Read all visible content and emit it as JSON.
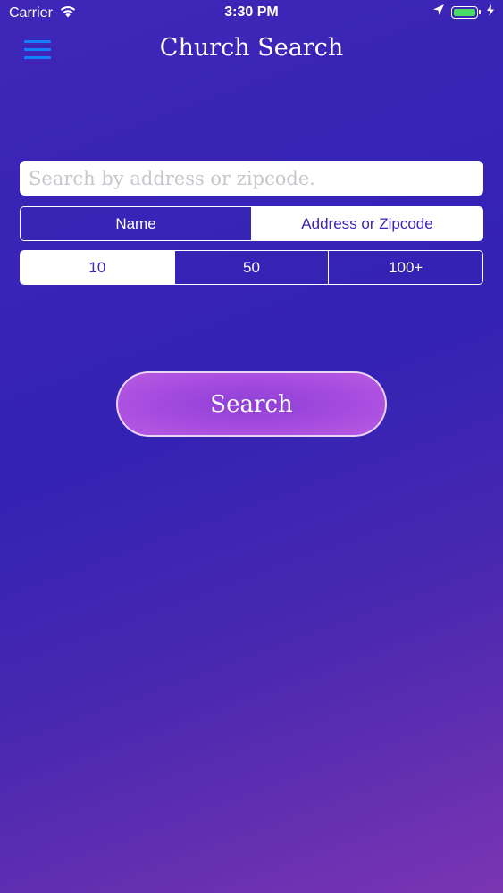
{
  "status_bar": {
    "carrier": "Carrier",
    "time": "3:30 PM",
    "icons": [
      "wifi-icon",
      "location-arrow-icon",
      "battery-icon",
      "charging-bolt-icon"
    ],
    "battery_color": "#4cd964"
  },
  "nav": {
    "title": "Church Search",
    "menu_icon": "hamburger-menu-icon",
    "menu_color": "#147efb"
  },
  "search": {
    "placeholder": "Search by address or zipcode.",
    "value": ""
  },
  "search_type": {
    "options": [
      "Name",
      "Address or Zipcode"
    ],
    "selected": "Address or Zipcode"
  },
  "range": {
    "options": [
      "10",
      "50",
      "100+"
    ],
    "selected": "10"
  },
  "search_button": {
    "label": "Search"
  },
  "colors": {
    "background_start": "#3f26b8",
    "background_end": "#7a35b2",
    "button_accent": "#a64cdf"
  }
}
